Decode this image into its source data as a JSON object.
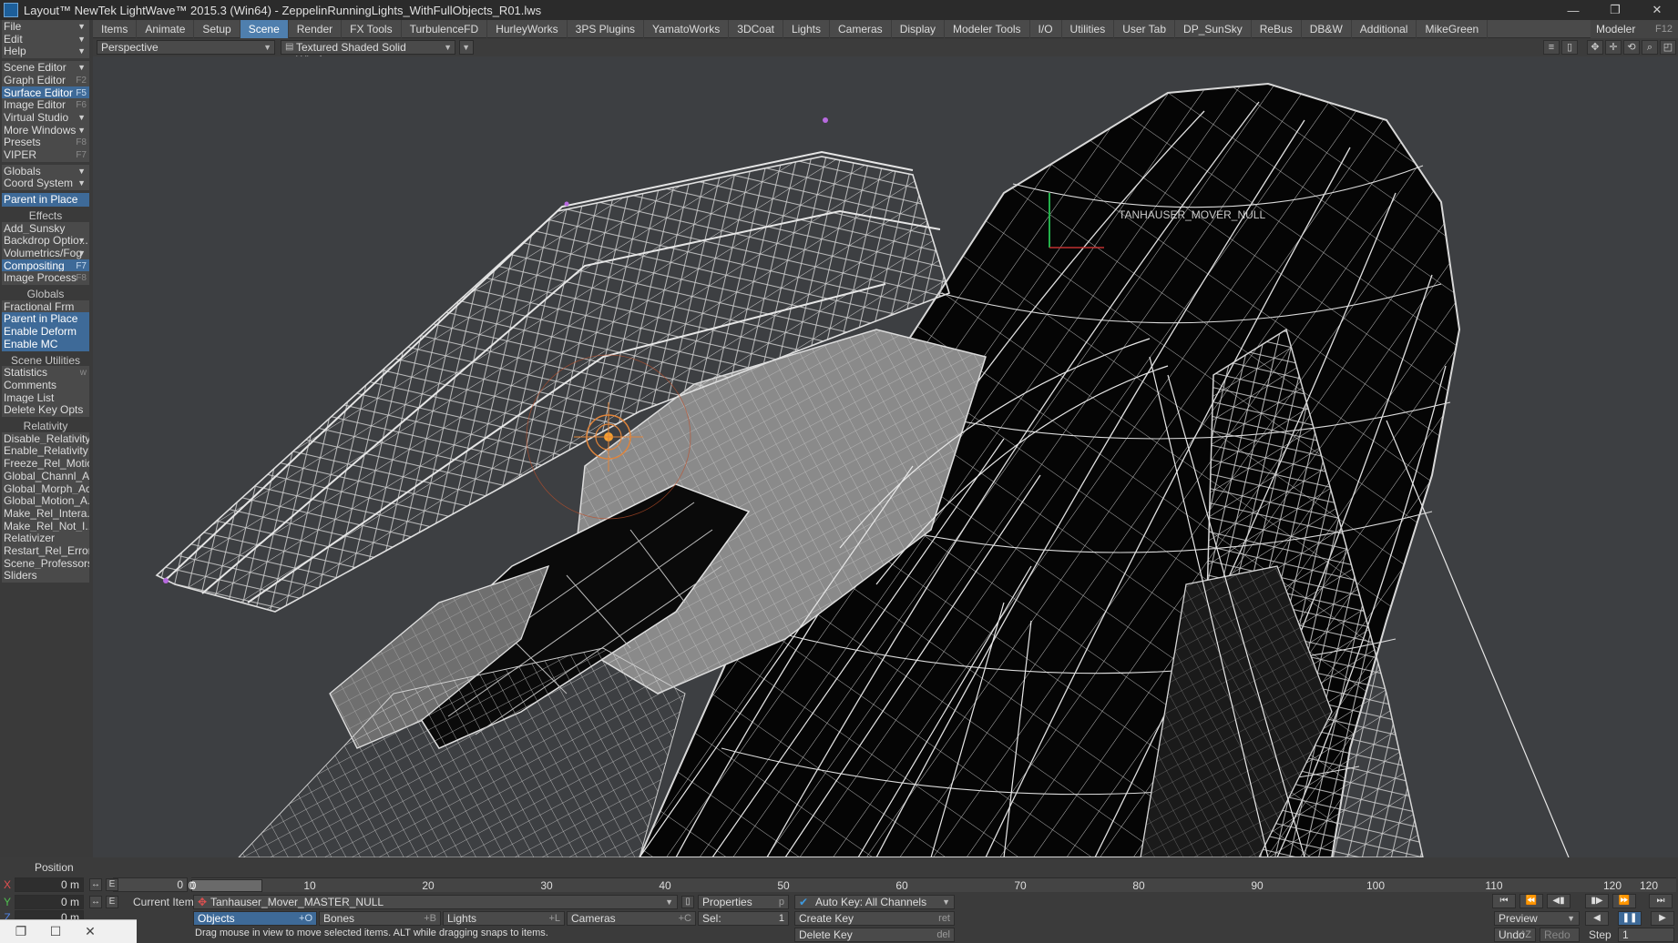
{
  "window": {
    "title": "Layout™ NewTek LightWave™ 2015.3 (Win64) - ZeppelinRunningLights_WithFullObjects_R01.lws",
    "minimize": "—",
    "restore": "❐",
    "close": "✕"
  },
  "tabs": [
    {
      "label": "Items"
    },
    {
      "label": "Animate"
    },
    {
      "label": "Setup"
    },
    {
      "label": "Scene"
    },
    {
      "label": "Render"
    },
    {
      "label": "FX Tools"
    },
    {
      "label": "TurbulenceFD"
    },
    {
      "label": "HurleyWorks"
    },
    {
      "label": "3PS Plugins"
    },
    {
      "label": "YamatoWorks"
    },
    {
      "label": "3DCoat"
    },
    {
      "label": "Lights"
    },
    {
      "label": "Cameras"
    },
    {
      "label": "Display"
    },
    {
      "label": "Modeler Tools"
    },
    {
      "label": "I/O"
    },
    {
      "label": "Utilities"
    },
    {
      "label": "User Tab"
    },
    {
      "label": "DP_SunSky"
    },
    {
      "label": "ReBus"
    },
    {
      "label": "DB&W"
    },
    {
      "label": "Additional"
    },
    {
      "label": "MikeGreen"
    }
  ],
  "active_tab": "Scene",
  "modeler": {
    "label": "Modeler",
    "key": "F12"
  },
  "viewport": {
    "view_mode": "Perspective",
    "render_mode": "Textured Shaded Solid Wireframe",
    "overlay_label": "TANHAUSER_MOVER_NULL"
  },
  "left_panel": {
    "menus": [
      {
        "label": "File"
      },
      {
        "label": "Edit"
      },
      {
        "label": "Help"
      }
    ],
    "windows": [
      {
        "label": "Scene Editor",
        "key": "",
        "dropdown": true,
        "highlight": false
      },
      {
        "label": "Graph Editor",
        "key": "F2",
        "dropdown": false,
        "highlight": false
      },
      {
        "label": "Surface Editor",
        "key": "F5",
        "dropdown": false,
        "highlight": true
      },
      {
        "label": "Image Editor",
        "key": "F6",
        "dropdown": false,
        "highlight": false
      },
      {
        "label": "Virtual Studio",
        "key": "",
        "dropdown": true,
        "highlight": false
      },
      {
        "label": "More Windows",
        "key": "",
        "dropdown": true,
        "highlight": false
      },
      {
        "label": "Presets",
        "key": "F8",
        "dropdown": false,
        "highlight": false
      },
      {
        "label": "VIPER",
        "key": "F7",
        "dropdown": false,
        "highlight": false
      }
    ],
    "settings": [
      {
        "label": "Globals",
        "dropdown": true
      },
      {
        "label": "Coord System",
        "dropdown": true
      }
    ],
    "parent_in_place": "Parent in Place",
    "effects_header": "Effects",
    "effects": [
      {
        "label": "Add_Sunsky",
        "key": "",
        "dropdown": false,
        "highlight": false
      },
      {
        "label": "Backdrop Optio...",
        "key": "",
        "dropdown": true,
        "highlight": false
      },
      {
        "label": "Volumetrics/Fog",
        "key": "",
        "dropdown": true,
        "highlight": false
      },
      {
        "label": "Compositing",
        "key": "F7",
        "dropdown": false,
        "highlight": true
      },
      {
        "label": "Image Process",
        "key": "F8",
        "dropdown": false,
        "highlight": false
      }
    ],
    "globals_header": "Globals",
    "globals": [
      {
        "label": "Fractional Frm",
        "highlight": false
      },
      {
        "label": "Parent in Place",
        "highlight": true
      },
      {
        "label": "Enable Deform",
        "highlight": true
      },
      {
        "label": "Enable MC",
        "highlight": true
      }
    ],
    "utilities_header": "Scene Utilities",
    "utilities": [
      {
        "label": "Statistics",
        "key": "w"
      },
      {
        "label": "Comments",
        "key": ""
      },
      {
        "label": "Image List",
        "key": ""
      },
      {
        "label": "Delete Key Opts",
        "key": ""
      }
    ],
    "relativity_header": "Relativity",
    "relativity": [
      {
        "label": "Disable_Relativity"
      },
      {
        "label": "Enable_Relativity"
      },
      {
        "label": "Freeze_Rel_Motion"
      },
      {
        "label": "Global_Channl_A..."
      },
      {
        "label": "Global_Morph_Ac..."
      },
      {
        "label": "Global_Motion_A..."
      },
      {
        "label": "Make_Rel_Intera..."
      },
      {
        "label": "Make_Rel_Not_I..."
      },
      {
        "label": "Relativizer"
      },
      {
        "label": "Restart_Rel_Errors"
      },
      {
        "label": "Scene_Professors"
      },
      {
        "label": "Sliders"
      }
    ]
  },
  "bottom": {
    "position_label": "Position",
    "x_label": "X",
    "y_label": "Y",
    "z_label": "Z",
    "x_value": "0 m",
    "y_value": "0 m",
    "z_value": "0 m",
    "e_label": "E",
    "frame_field": "0",
    "current_item_label": "Current Item",
    "current_item": "Tanhauser_Mover_MASTER_NULL",
    "properties": {
      "label": "Properties",
      "key": "p"
    },
    "auto_key": "Auto Key: All Channels",
    "objects": {
      "label": "Objects",
      "key": "+O"
    },
    "bones": {
      "label": "Bones",
      "key": "+B"
    },
    "lights": {
      "label": "Lights",
      "key": "+L"
    },
    "cameras": {
      "label": "Cameras",
      "key": "+C"
    },
    "sel_label": "Sel:",
    "sel_value": "1",
    "create_key": {
      "label": "Create Key",
      "key": "ret"
    },
    "delete_key": {
      "label": "Delete Key",
      "key": "del"
    },
    "status": "Drag mouse in view to move selected items. ALT while dragging snaps to items.",
    "preview": "Preview",
    "undo": "Undo",
    "undo_key": "^Z",
    "redo": "Redo",
    "step_label": "Step",
    "step_value": "1",
    "end_frame": "120",
    "timeline_ticks": [
      "0",
      "10",
      "20",
      "30",
      "40",
      "50",
      "60",
      "70",
      "80",
      "90",
      "100",
      "110",
      "120"
    ],
    "current_frame_marker": "0"
  },
  "icons": {
    "transport": [
      "skip-start-icon",
      "prev-key-icon",
      "play-back-icon",
      "play-icon",
      "next-key-icon",
      "skip-end-icon"
    ]
  },
  "colors": {
    "accent": "#4f7fae",
    "highlight": "#3e6a98",
    "viewport_bg": "#3d3f42",
    "wire": "#c8c8c8",
    "panel": "#3a3a3a"
  }
}
